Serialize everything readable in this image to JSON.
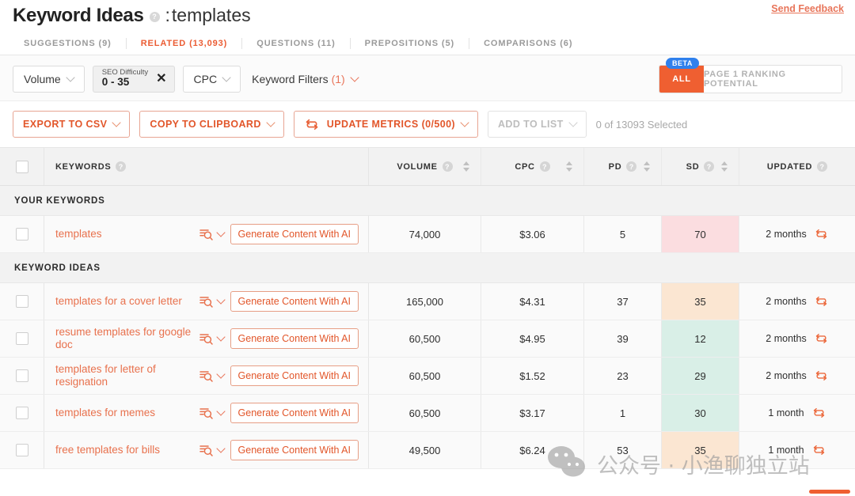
{
  "header": {
    "title": "Keyword Ideas",
    "help_icon": "help-circle-icon",
    "separator": ":",
    "query": "templates",
    "send_feedback": "Send Feedback"
  },
  "tabs": [
    {
      "label": "SUGGESTIONS (9)",
      "active": false
    },
    {
      "label": "RELATED (13,093)",
      "active": true
    },
    {
      "label": "QUESTIONS (11)",
      "active": false
    },
    {
      "label": "PREPOSITIONS (5)",
      "active": false
    },
    {
      "label": "COMPARISONS (6)",
      "active": false
    }
  ],
  "filter_bar": {
    "volume": "Volume",
    "seo_difficulty_label": "SEO Difficulty",
    "seo_difficulty_value": "0 - 35",
    "seo_difficulty_clear": "✕",
    "cpc": "CPC",
    "keyword_filters": "Keyword Filters",
    "keyword_filters_count": "(1)",
    "beta_badge": "BETA",
    "toggle_all": "ALL",
    "toggle_page1": "PAGE 1 RANKING POTENTIAL"
  },
  "action_bar": {
    "export_csv": "EXPORT TO CSV",
    "copy_clipboard": "COPY TO CLIPBOARD",
    "update_metrics": "UPDATE METRICS",
    "update_metrics_count": "(0/500)",
    "add_to_list": "ADD TO LIST",
    "selection_status": "0 of 13093 Selected"
  },
  "table": {
    "columns": {
      "keywords": "KEYWORDS",
      "volume": "VOLUME",
      "cpc": "CPC",
      "pd": "PD",
      "sd": "SD",
      "updated": "UPDATED"
    },
    "groups": [
      {
        "label": "YOUR KEYWORDS",
        "rows": [
          {
            "keyword": "templates",
            "generate_label": "Generate Content With AI",
            "volume": "74,000",
            "cpc": "$3.06",
            "pd": "5",
            "sd": "70",
            "sd_color": "#fbdde0",
            "updated": "2 months"
          }
        ]
      },
      {
        "label": "KEYWORD IDEAS",
        "rows": [
          {
            "keyword": "templates for a cover letter",
            "generate_label": "Generate Content With AI",
            "volume": "165,000",
            "cpc": "$4.31",
            "pd": "37",
            "sd": "35",
            "sd_color": "#fbe6d2",
            "updated": "2 months"
          },
          {
            "keyword": "resume templates for google doc",
            "generate_label": "Generate Content With AI",
            "volume": "60,500",
            "cpc": "$4.95",
            "pd": "39",
            "sd": "12",
            "sd_color": "#d9efe7",
            "updated": "2 months"
          },
          {
            "keyword": "templates for letter of resignation",
            "generate_label": "Generate Content With AI",
            "volume": "60,500",
            "cpc": "$1.52",
            "pd": "23",
            "sd": "29",
            "sd_color": "#d9efe7",
            "updated": "2 months"
          },
          {
            "keyword": "templates for memes",
            "generate_label": "Generate Content With AI",
            "volume": "60,500",
            "cpc": "$3.17",
            "pd": "1",
            "sd": "30",
            "sd_color": "#d9efe7",
            "updated": "1 month"
          },
          {
            "keyword": "free templates for bills",
            "generate_label": "Generate Content With AI",
            "volume": "49,500",
            "cpc": "$6.24",
            "pd": "53",
            "sd": "35",
            "sd_color": "#fbe6d2",
            "updated": "1 month"
          }
        ]
      }
    ]
  },
  "watermark": {
    "icon": "wechat-logo-icon",
    "text": "公众号 · 小渔聊独立站"
  },
  "colors": {
    "accent": "#eb5c33",
    "link": "#e8714d",
    "beta": "#2f80ed"
  }
}
